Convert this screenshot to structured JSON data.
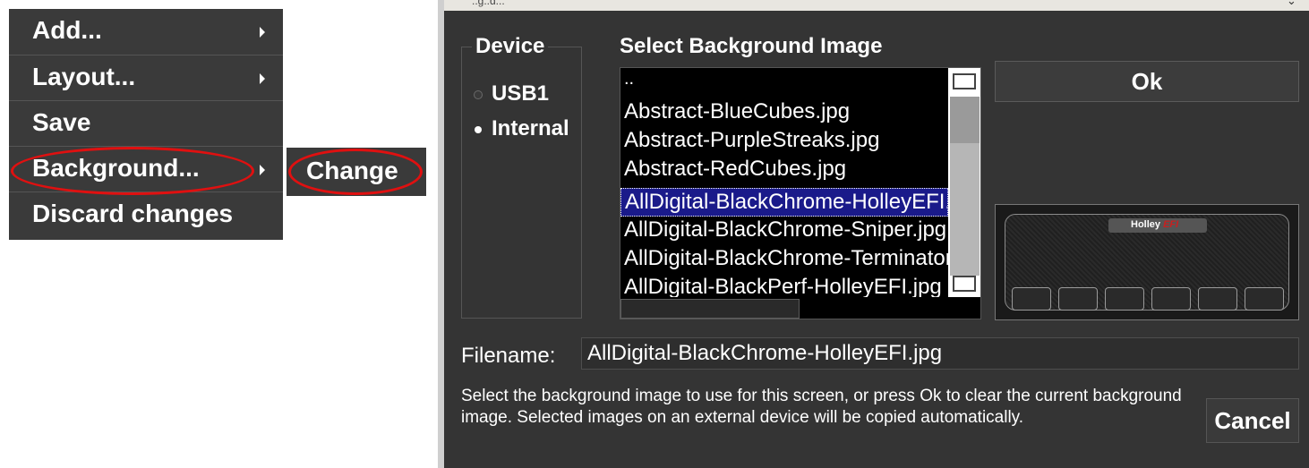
{
  "context_menu": {
    "items": [
      {
        "label": "Add...",
        "has_submenu": true
      },
      {
        "label": "Layout...",
        "has_submenu": true
      },
      {
        "label": "Save",
        "has_submenu": false
      },
      {
        "label": "Background...",
        "has_submenu": true
      },
      {
        "label": "Discard changes",
        "has_submenu": false
      }
    ],
    "submenu": {
      "label": "Change"
    }
  },
  "dialog": {
    "title": "..g..d...",
    "device": {
      "legend": "Device",
      "options": [
        {
          "label": "USB1",
          "selected": false
        },
        {
          "label": "Internal",
          "selected": true
        }
      ]
    },
    "file_list": {
      "title": "Select Background Image",
      "items": [
        "..",
        "Abstract-BlueCubes.jpg",
        "Abstract-PurpleStreaks.jpg",
        "Abstract-RedCubes.jpg",
        "AllDigital-BlackChrome-HolleyEFI.jpg",
        "AllDigital-BlackChrome-Sniper.jpg",
        "AllDigital-BlackChrome-Terminator.jpg",
        "AllDigital-BlackPerf-HolleyEFI.jpg"
      ],
      "selected_index": 4
    },
    "ok_label": "Ok",
    "preview": {
      "logo_text": "Holley",
      "logo_accent": "EFI"
    },
    "filename": {
      "label": "Filename:",
      "value": "AllDigital-BlackChrome-HolleyEFI.jpg"
    },
    "help_text": "Select the background image to use for this screen, or press Ok to clear the current background image. Selected images on an external device will be copied automatically.",
    "cancel_label": "Cancel"
  },
  "colors": {
    "menu_bg": "#3a3a3a",
    "dialog_bg": "#343434",
    "selection": "#1a1a8a",
    "highlight_oval": "#e01010"
  }
}
